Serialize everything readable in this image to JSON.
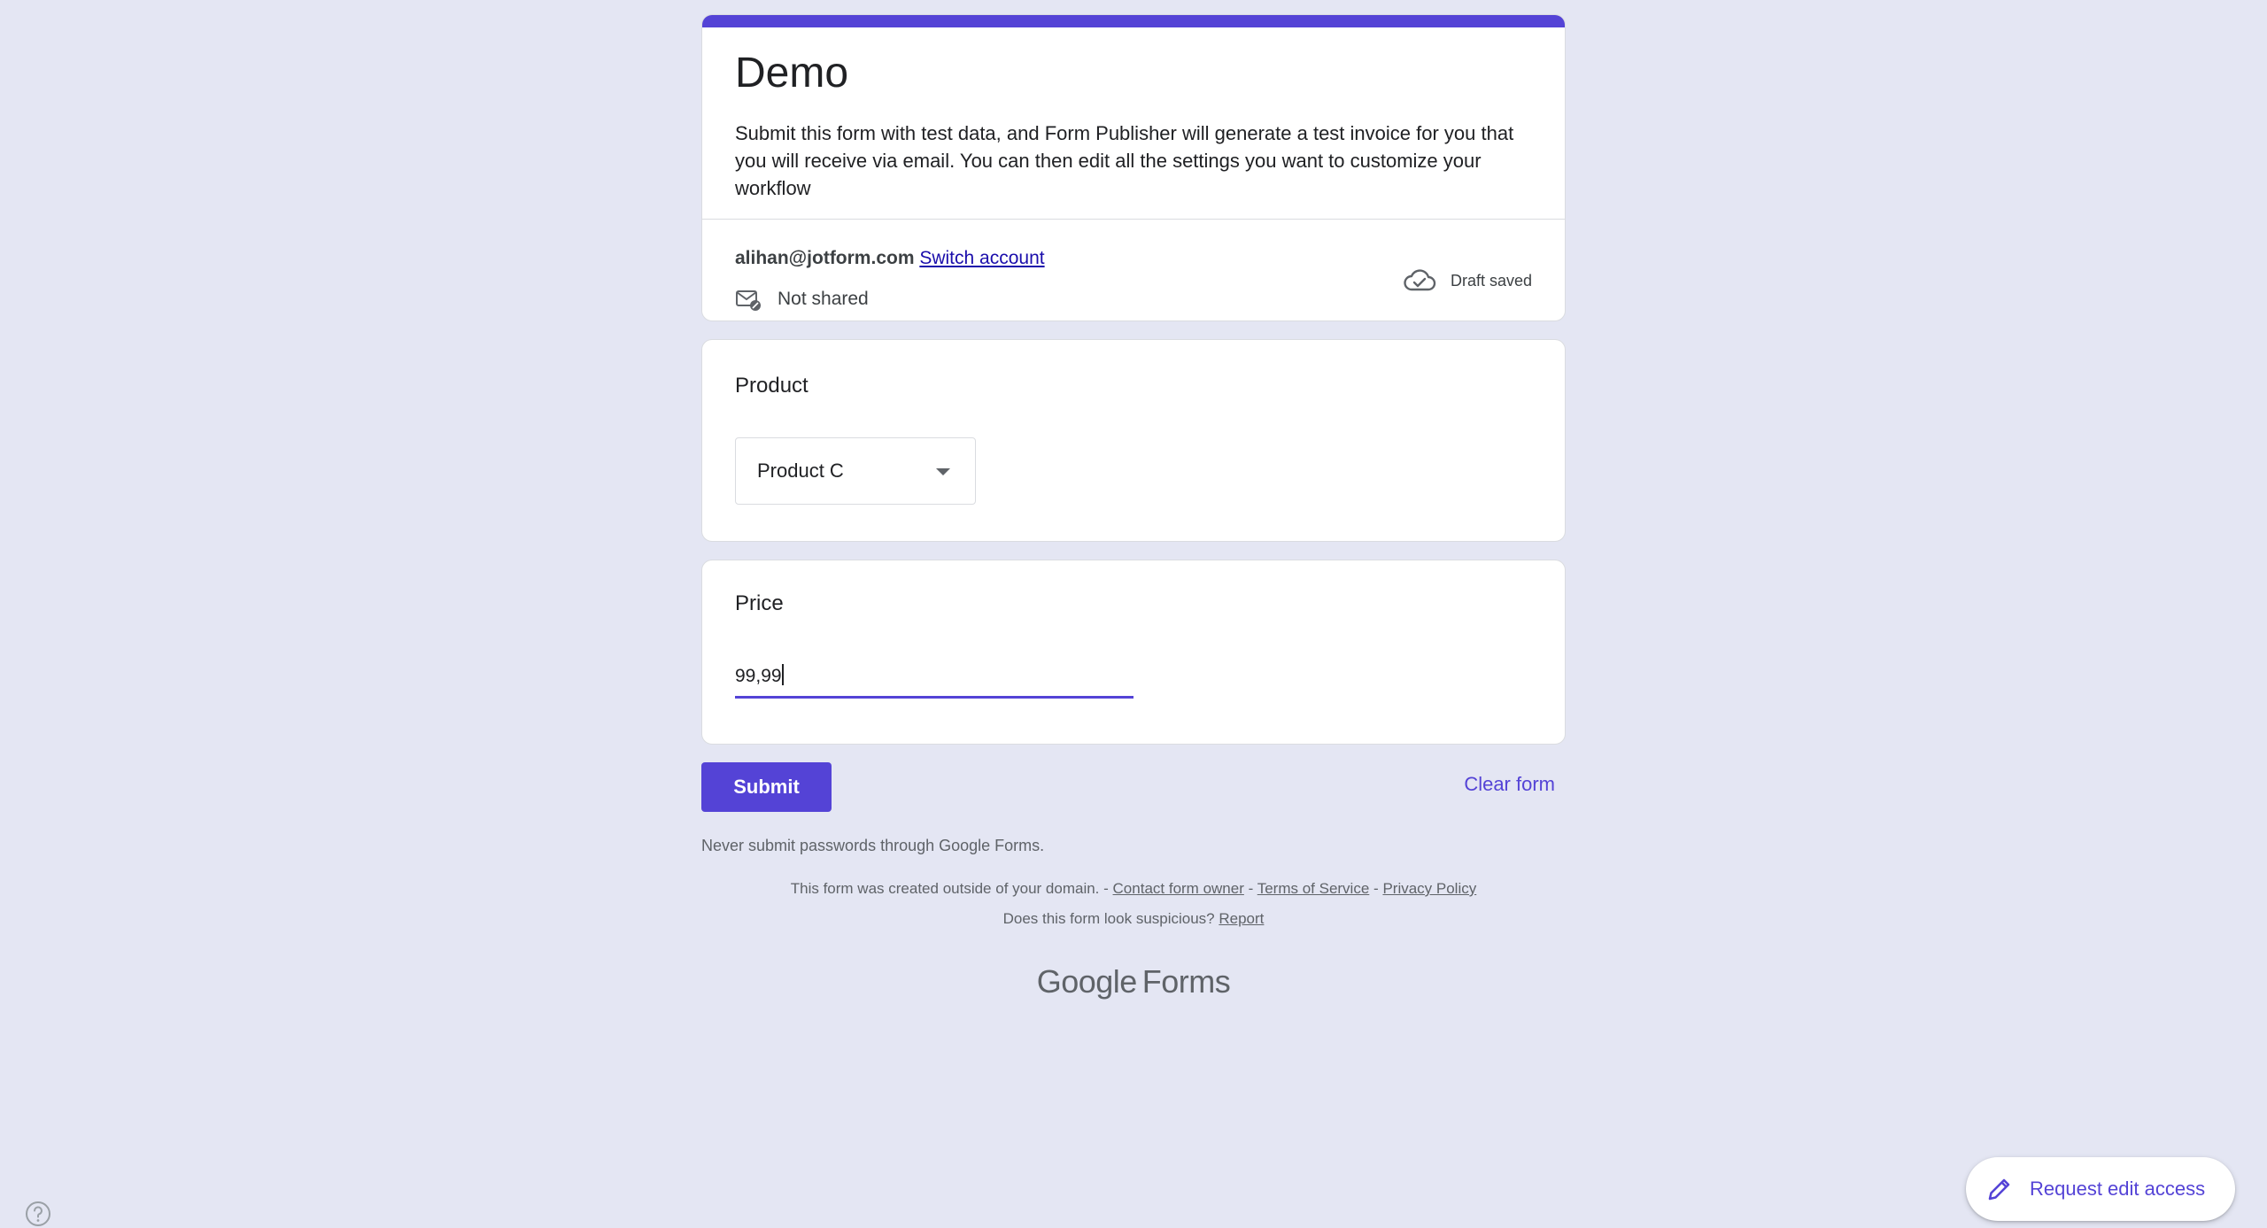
{
  "form": {
    "title": "Demo",
    "description": "Submit this form with test data, and Form Publisher will generate a test invoice for you that you will receive via email. You can then edit all the settings you want to customize your workflow",
    "accent_color": "#5443d6"
  },
  "account": {
    "email": "alihan@jotform.com",
    "switch_label": "Switch account",
    "shared_status": "Not shared",
    "draft_status": "Draft saved"
  },
  "questions": {
    "product": {
      "title": "Product",
      "selected": "Product C"
    },
    "price": {
      "title": "Price",
      "value": "99,99"
    }
  },
  "actions": {
    "submit_label": "Submit",
    "clear_label": "Clear form"
  },
  "notes": {
    "password_warning": "Never submit passwords through Google Forms.",
    "domain_text": "This form was created outside of your domain. -",
    "contact_owner": "Contact form owner",
    "separator": "-",
    "terms": "Terms of Service",
    "privacy": "Privacy Policy",
    "suspicious_text": "Does this form look suspicious?",
    "report": "Report"
  },
  "brand": {
    "google": "Google",
    "forms": "Forms"
  },
  "request_edit": {
    "label": "Request edit access"
  },
  "icons": {
    "mail": "mail-not-shared-icon",
    "cloud": "cloud-done-icon",
    "help": "help-icon",
    "pencil": "pencil-icon",
    "dropdown": "dropdown-arrow-icon"
  }
}
